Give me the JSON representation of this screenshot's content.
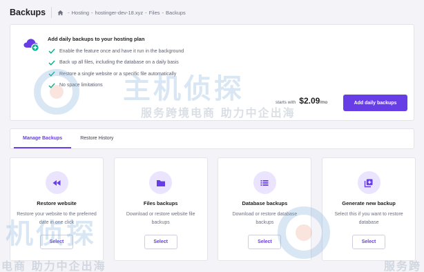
{
  "header": {
    "title": "Backups",
    "breadcrumb": [
      "Hosting",
      "hostinger-dev-18.xyz",
      "Files",
      "Backups"
    ],
    "breadcrumb_separator": "-"
  },
  "promo": {
    "title": "Add daily backups to your hosting plan",
    "features": [
      "Enable the feature once and have it run in the background",
      "Back up all files, including the database on a daily basis",
      "Restore a single website or a specific file automatically",
      "No space limitations"
    ],
    "starts_with": "starts with",
    "price": "$2.09",
    "per": "/mo",
    "cta_label": "Add daily backups"
  },
  "tabs": [
    {
      "label": "Manage Backups",
      "active": true
    },
    {
      "label": "Restore History",
      "active": false
    }
  ],
  "cards": [
    {
      "icon": "rewind-icon",
      "title": "Restore website",
      "description": "Restore your website to the preferred date in one click",
      "button": "Select"
    },
    {
      "icon": "folder-icon",
      "title": "Files backups",
      "description": "Download or restore website file backups",
      "button": "Select"
    },
    {
      "icon": "list-icon",
      "title": "Database backups",
      "description": "Download or restore database backups",
      "button": "Select"
    },
    {
      "icon": "add-library-icon",
      "title": "Generate new backup",
      "description": "Select this if you want to restore database",
      "button": "Select"
    }
  ],
  "watermark": {
    "brand": "主机侦探",
    "slogan": "服务跨境电商 助力中企出海",
    "slogan_cut_left": "电商 助力中企出海",
    "slogan_cut_right": "服务跨",
    "brand_cut": "机侦探"
  },
  "colors": {
    "accent": "#673de6",
    "success": "#00b090",
    "text_dark": "#1d1e20",
    "icon_bg": "#ebe4ff"
  }
}
